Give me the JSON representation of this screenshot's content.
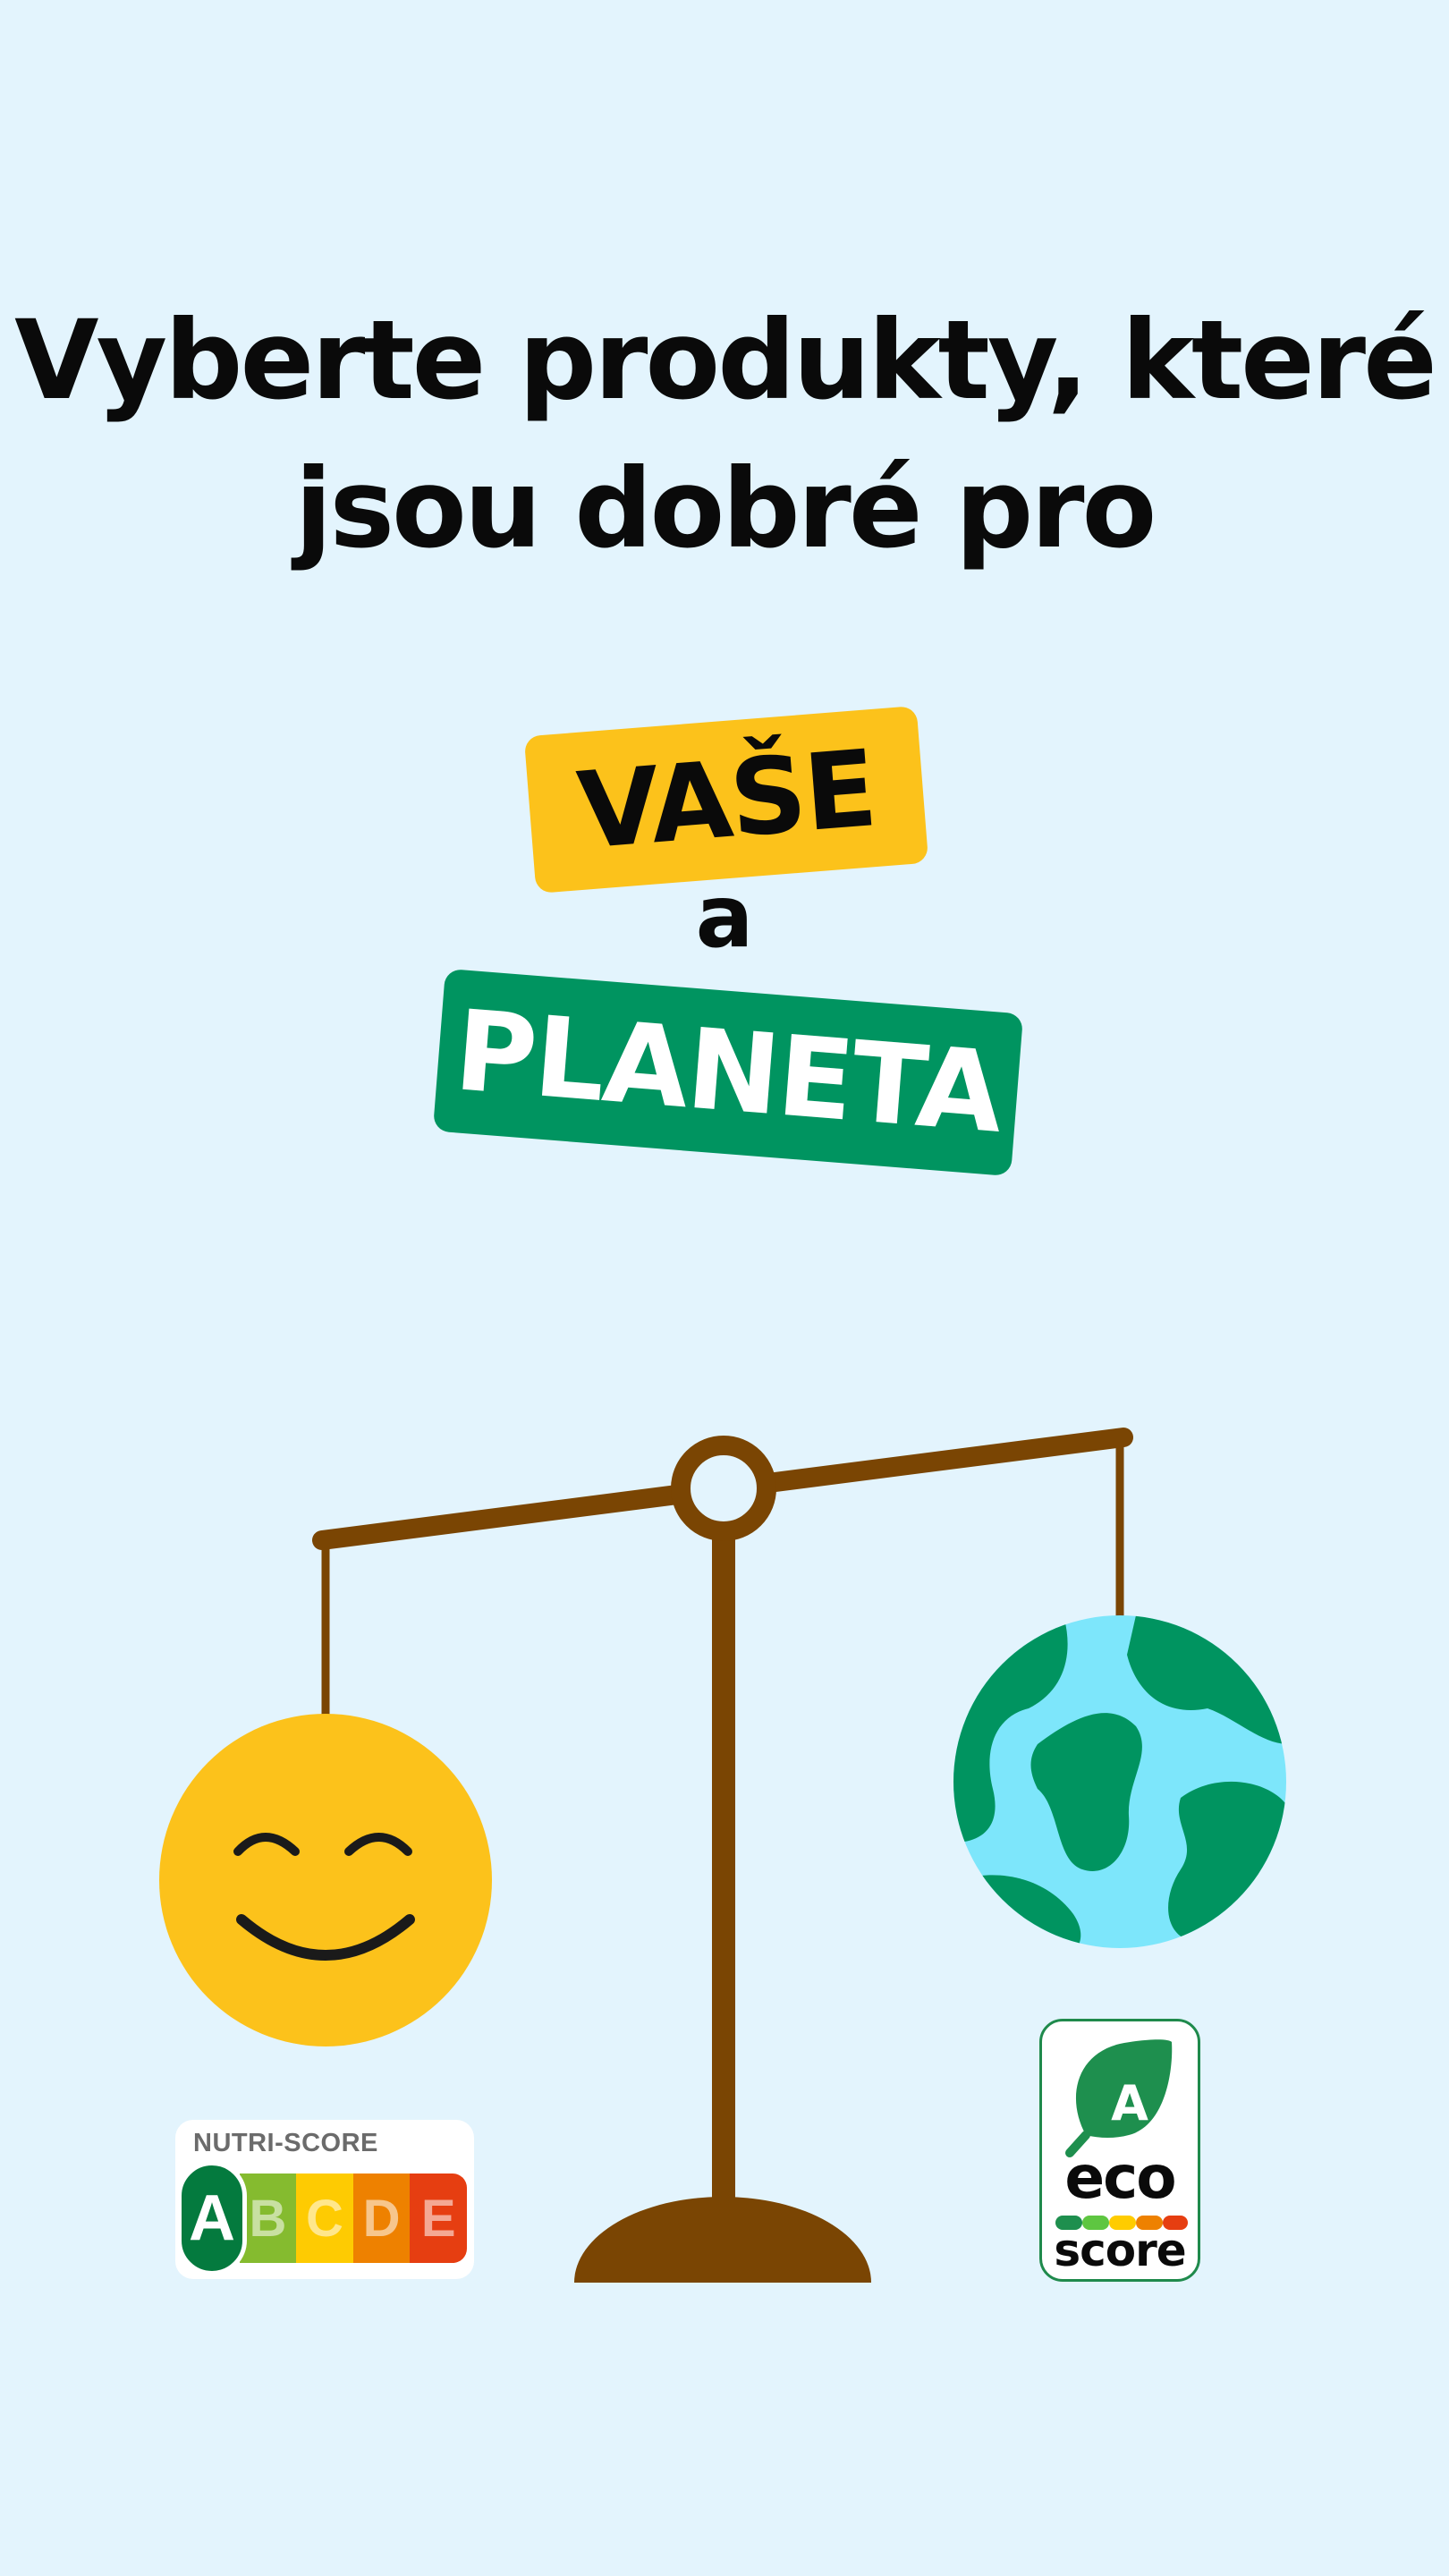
{
  "headline": {
    "line1": "Vyberte produkty, které",
    "line2": "jsou dobré pro"
  },
  "tag_yours": "VAŠE",
  "conjunction": "a",
  "tag_planet": "PLANETA",
  "colors": {
    "background": "#e3f4fd",
    "yellow": "#fcc21b",
    "green": "#009460",
    "brown": "#7a4503",
    "ocean": "#7de6fb"
  },
  "illustration": {
    "left_item": "smiling-face-icon",
    "right_item": "earth-globe-icon",
    "balance": "balance-scale-icon"
  },
  "nutri_score": {
    "label": "NUTRI-SCORE",
    "grades": [
      "A",
      "B",
      "C",
      "D",
      "E"
    ],
    "active": "A",
    "grade_colors": [
      "#047a3e",
      "#85bb2f",
      "#fecb02",
      "#ee8100",
      "#e63e11"
    ]
  },
  "eco_score": {
    "grade": "A",
    "word": "eco",
    "sub": "score",
    "dot_colors": [
      "#1e8f4e",
      "#5ec641",
      "#ffcc00",
      "#ee8100",
      "#e63e11"
    ]
  }
}
